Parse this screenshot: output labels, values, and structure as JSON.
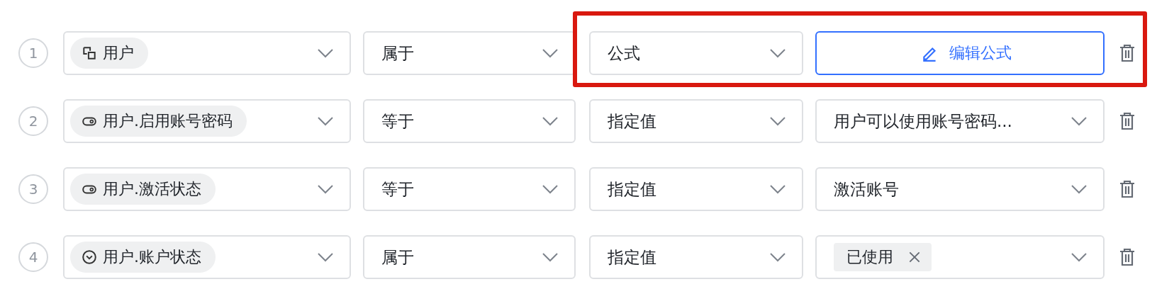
{
  "rows": [
    {
      "index": "1",
      "highlighted": true,
      "field": {
        "kind": "relation",
        "label": "用户"
      },
      "operator": "属于",
      "source": "公式",
      "value": {
        "kind": "button",
        "label": "编辑公式"
      }
    },
    {
      "index": "2",
      "highlighted": false,
      "field": {
        "kind": "toggle",
        "label": "用户.启用账号密码"
      },
      "operator": "等于",
      "source": "指定值",
      "value": {
        "kind": "select",
        "label": "用户可以使用账号密码..."
      }
    },
    {
      "index": "3",
      "highlighted": false,
      "field": {
        "kind": "toggle",
        "label": "用户.激活状态"
      },
      "operator": "等于",
      "source": "指定值",
      "value": {
        "kind": "select",
        "label": "激活账号"
      }
    },
    {
      "index": "4",
      "highlighted": false,
      "field": {
        "kind": "option",
        "label": "用户.账户状态"
      },
      "operator": "属于",
      "source": "指定值",
      "value": {
        "kind": "tags",
        "tags": [
          "已使用"
        ]
      }
    }
  ]
}
